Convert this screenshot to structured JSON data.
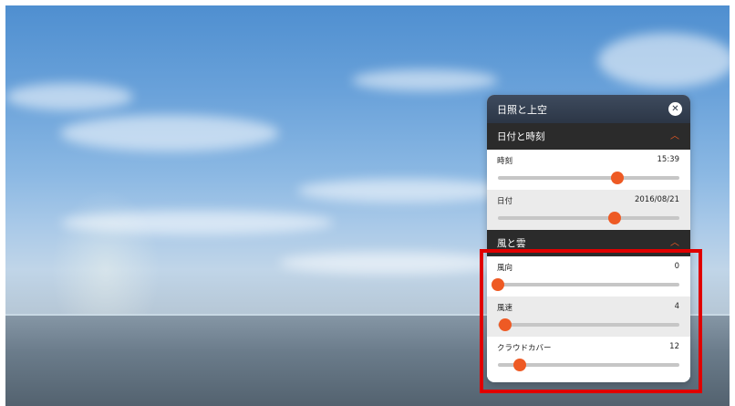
{
  "panel": {
    "title": "日照と上空",
    "close_icon": "close-icon"
  },
  "sections": [
    {
      "title": "日付と時刻",
      "chevron": "chevron-up-icon",
      "sliders": [
        {
          "label": "時刻",
          "value": "15:39",
          "fraction": 0.66
        },
        {
          "label": "日付",
          "value": "2016/08/21",
          "fraction": 0.645
        }
      ]
    },
    {
      "title": "風と雲",
      "chevron": "chevron-up-icon",
      "sliders": [
        {
          "label": "風向",
          "value": "0",
          "fraction": 0.0
        },
        {
          "label": "風速",
          "value": "4",
          "fraction": 0.04
        },
        {
          "label": "クラウドカバー",
          "value": "12",
          "fraction": 0.12
        }
      ]
    }
  ],
  "colors": {
    "accent": "#ee5a24",
    "highlight": "#e00000",
    "header": "#2c3646",
    "section": "#2b2b2b"
  }
}
